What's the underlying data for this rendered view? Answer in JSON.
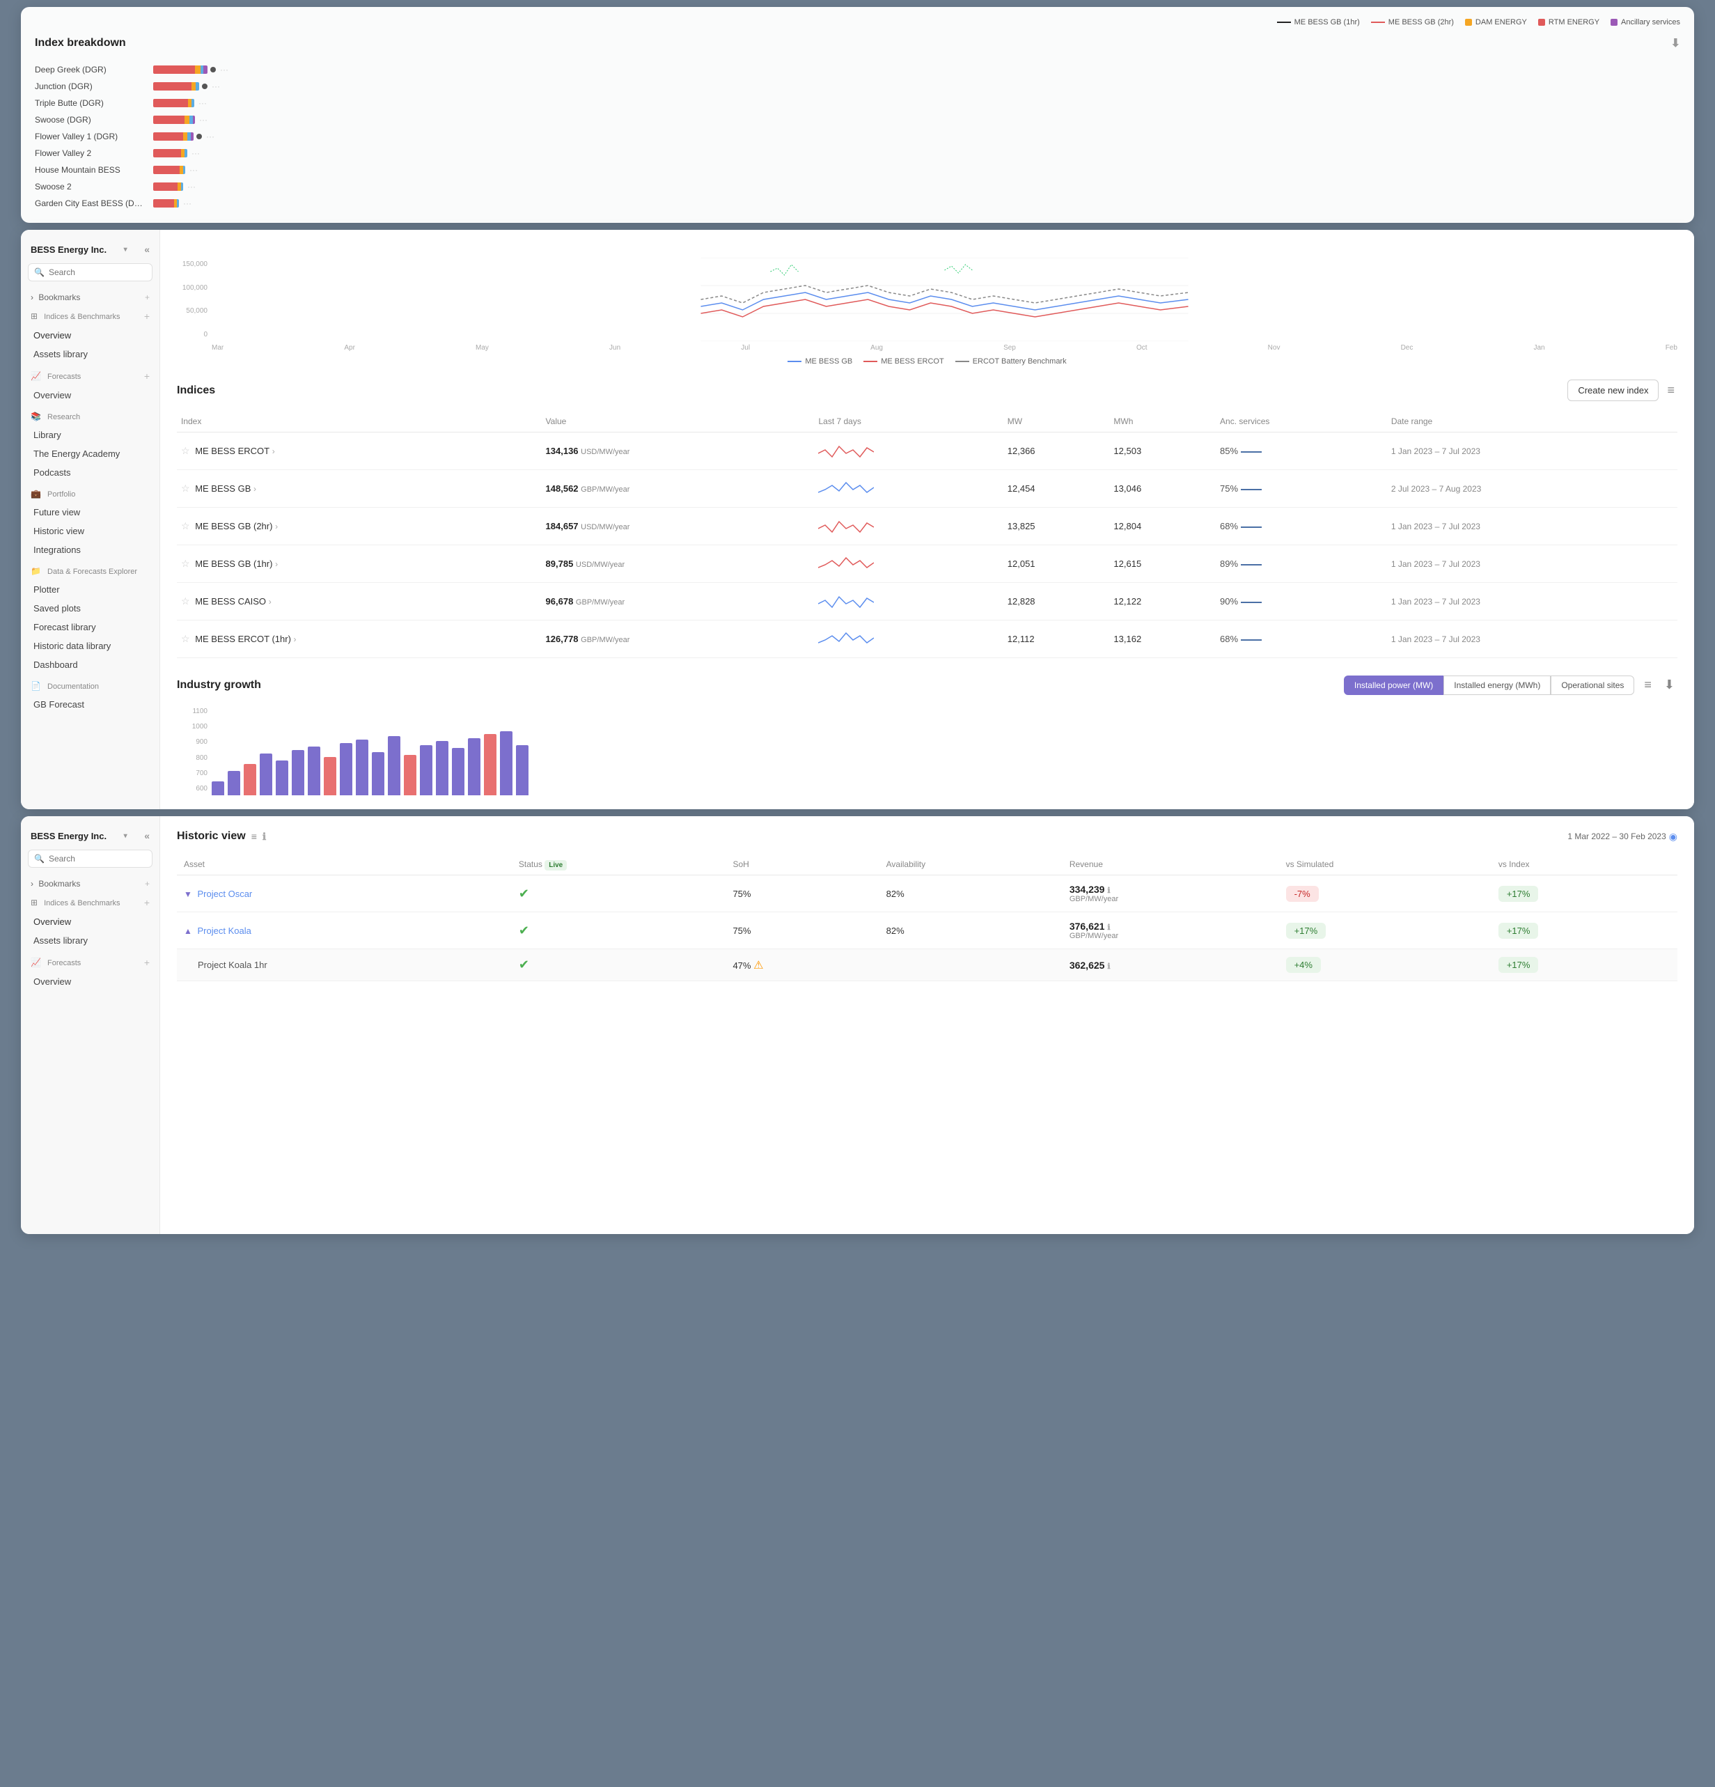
{
  "topPanel": {
    "legend": [
      {
        "label": "ME BESS GB (1hr)",
        "type": "line",
        "color": "#222"
      },
      {
        "label": "ME BESS GB (2hr)",
        "type": "line",
        "color": "#e05a5a"
      },
      {
        "label": "DAM ENERGY",
        "type": "square",
        "color": "#f5a623"
      },
      {
        "label": "RTM ENERGY",
        "type": "square",
        "color": "#e05a5a"
      },
      {
        "label": "Ancillary services",
        "type": "square",
        "color": "#9b59b6"
      }
    ],
    "breakdown": {
      "title": "Index breakdown",
      "rows": [
        {
          "label": "Deep Greek (DGR)",
          "segments": [
            {
              "w": 60,
              "c": "#e05a5a"
            },
            {
              "w": 8,
              "c": "#f5a623"
            },
            {
              "w": 4,
              "c": "#5dade2"
            },
            {
              "w": 6,
              "c": "#9b59b6"
            }
          ],
          "dot": true
        },
        {
          "label": "Junction (DGR)",
          "segments": [
            {
              "w": 55,
              "c": "#e05a5a"
            },
            {
              "w": 6,
              "c": "#f5a623"
            },
            {
              "w": 5,
              "c": "#5dade2"
            }
          ],
          "dot": true
        },
        {
          "label": "Triple Butte (DGR)",
          "segments": [
            {
              "w": 50,
              "c": "#e05a5a"
            },
            {
              "w": 5,
              "c": "#f5a623"
            },
            {
              "w": 4,
              "c": "#5dade2"
            }
          ],
          "dot": false
        },
        {
          "label": "Swoose (DGR)",
          "segments": [
            {
              "w": 45,
              "c": "#e05a5a"
            },
            {
              "w": 7,
              "c": "#f5a623"
            },
            {
              "w": 5,
              "c": "#5dade2"
            },
            {
              "w": 3,
              "c": "#9b59b6"
            }
          ],
          "dot": false
        },
        {
          "label": "Flower Valley 1 (DGR)",
          "segments": [
            {
              "w": 43,
              "c": "#e05a5a"
            },
            {
              "w": 6,
              "c": "#f5a623"
            },
            {
              "w": 5,
              "c": "#5dade2"
            },
            {
              "w": 4,
              "c": "#9b59b6"
            }
          ],
          "dot": true
        },
        {
          "label": "Flower Valley 2",
          "segments": [
            {
              "w": 40,
              "c": "#e05a5a"
            },
            {
              "w": 5,
              "c": "#f5a623"
            },
            {
              "w": 4,
              "c": "#5dade2"
            }
          ],
          "dot": false
        },
        {
          "label": "House Mountain BESS",
          "segments": [
            {
              "w": 38,
              "c": "#e05a5a"
            },
            {
              "w": 5,
              "c": "#f5a623"
            },
            {
              "w": 3,
              "c": "#5dade2"
            }
          ],
          "dot": false
        },
        {
          "label": "Swoose 2",
          "segments": [
            {
              "w": 35,
              "c": "#e05a5a"
            },
            {
              "w": 5,
              "c": "#f5a623"
            },
            {
              "w": 3,
              "c": "#5dade2"
            }
          ],
          "dot": false
        },
        {
          "label": "Garden City East BESS (DGR)",
          "segments": [
            {
              "w": 30,
              "c": "#e05a5a"
            },
            {
              "w": 4,
              "c": "#f5a623"
            },
            {
              "w": 3,
              "c": "#5dade2"
            }
          ],
          "dot": false
        }
      ]
    }
  },
  "window1": {
    "company": "BESS Energy Inc.",
    "search": {
      "placeholder": "Search"
    },
    "bookmarks": "Bookmarks",
    "sidebar": {
      "sections": [
        {
          "name": "Indices & Benchmarks",
          "icon": "chart-icon",
          "addable": true,
          "items": [
            "Overview",
            "Assets library"
          ]
        },
        {
          "name": "Forecasts",
          "icon": "forecast-icon",
          "addable": true,
          "items": [
            "Overview"
          ]
        },
        {
          "name": "Research",
          "icon": "research-icon",
          "addable": false,
          "items": [
            "Library",
            "The Energy Academy",
            "Podcasts"
          ]
        },
        {
          "name": "Portfolio",
          "icon": "portfolio-icon",
          "addable": false,
          "items": [
            "Future view",
            "Historic view",
            "Integrations"
          ]
        },
        {
          "name": "Data & Forecasts Explorer",
          "icon": "explorer-icon",
          "addable": false,
          "items": [
            "Plotter",
            "Saved plots",
            "Forecast library",
            "Historic data library",
            "Dashboard"
          ]
        },
        {
          "name": "Documentation",
          "icon": "doc-icon",
          "addable": false,
          "items": [
            "GB Forecast"
          ]
        }
      ]
    },
    "chart": {
      "yLabels": [
        "150,000",
        "100,000",
        "50,000",
        "0"
      ],
      "xLabels": [
        "Mar",
        "Apr",
        "May",
        "Jun",
        "Jul",
        "Aug",
        "Sep",
        "Oct",
        "Nov",
        "Dec",
        "Jan",
        "Feb"
      ],
      "legend": [
        {
          "label": "ME BESS GB",
          "type": "solid",
          "color": "#5b8dee"
        },
        {
          "label": "ME BESS ERCOT",
          "type": "solid",
          "color": "#e05a5a"
        },
        {
          "label": "ERCOT Battery Benchmark",
          "type": "dashed",
          "color": "#888"
        }
      ]
    },
    "indices": {
      "title": "Indices",
      "createBtn": "Create new index",
      "columns": [
        "Index",
        "Value",
        "Last 7 days",
        "MW",
        "MWh",
        "Anc. services",
        "Date range"
      ],
      "rows": [
        {
          "name": "ME BESS ERCOT",
          "value": "134,136",
          "unit": "USD/MW/year",
          "mw": "12,366",
          "mwh": "12,503",
          "anc": "85%",
          "dateRange": "1 Jan 2023 – 7 Jul 2023",
          "lineColor": "#e05a5a"
        },
        {
          "name": "ME BESS GB",
          "value": "148,562",
          "unit": "GBP/MW/year",
          "mw": "12,454",
          "mwh": "13,046",
          "anc": "75%",
          "dateRange": "2 Jul 2023 – 7 Aug 2023",
          "lineColor": "#5b8dee"
        },
        {
          "name": "ME BESS GB (2hr)",
          "value": "184,657",
          "unit": "USD/MW/year",
          "mw": "13,825",
          "mwh": "12,804",
          "anc": "68%",
          "dateRange": "1 Jan 2023 – 7 Jul 2023",
          "lineColor": "#e05a5a"
        },
        {
          "name": "ME BESS GB (1hr)",
          "value": "89,785",
          "unit": "USD/MW/year",
          "mw": "12,051",
          "mwh": "12,615",
          "anc": "89%",
          "dateRange": "1 Jan 2023 – 7 Jul 2023",
          "lineColor": "#e05a5a"
        },
        {
          "name": "ME BESS CAISO",
          "value": "96,678",
          "unit": "GBP/MW/year",
          "mw": "12,828",
          "mwh": "12,122",
          "anc": "90%",
          "dateRange": "1 Jan 2023 – 7 Jul 2023",
          "lineColor": "#5b8dee"
        },
        {
          "name": "ME BESS ERCOT (1hr)",
          "value": "126,778",
          "unit": "GBP/MW/year",
          "mw": "12,112",
          "mwh": "13,162",
          "anc": "68%",
          "dateRange": "1 Jan 2023 – 7 Jul 2023",
          "lineColor": "#5b8dee"
        }
      ]
    },
    "growth": {
      "title": "Industry growth",
      "tabs": [
        "Installed power (MW)",
        "Installed energy (MWh)",
        "Operational sites"
      ],
      "activeTab": 0,
      "yLabels": [
        "1100",
        "1000",
        "900",
        "800",
        "700",
        "600"
      ],
      "bars": [
        20,
        30,
        40,
        55,
        45,
        60,
        65,
        50,
        70,
        75,
        60,
        80,
        55,
        70,
        75,
        65,
        80,
        85,
        90,
        70
      ]
    }
  },
  "window2": {
    "company": "BESS Energy Inc.",
    "search": {
      "placeholder": "Search"
    },
    "bookmarks": "Bookmarks",
    "sidebar": {
      "sections": [
        {
          "name": "Indices & Benchmarks",
          "icon": "chart-icon",
          "addable": true,
          "items": [
            "Overview",
            "Assets library"
          ]
        },
        {
          "name": "Forecasts",
          "icon": "forecast-icon",
          "addable": true,
          "items": [
            "Overview"
          ]
        }
      ]
    },
    "historicView": {
      "title": "Historic view",
      "dateRange": "1 Mar 2022 – 30 Feb 2023",
      "liveBadge": "Live",
      "columns": [
        "Asset",
        "Status",
        "SoH",
        "Availability",
        "Revenue",
        "vs Simulated",
        "vs Index"
      ],
      "rows": [
        {
          "name": "Project Oscar",
          "expanded": false,
          "expandIcon": "▼",
          "statusOk": true,
          "soh": "75%",
          "availability": "82%",
          "revenue": "334,239",
          "revenueUnit": "GBP/MW/year",
          "vsSimulated": "-7%",
          "vsSimulatedNeg": true,
          "vsIndex": "+17%",
          "vsIndexPos": true
        },
        {
          "name": "Project Koala",
          "expanded": true,
          "expandIcon": "▲",
          "statusOk": true,
          "soh": "75%",
          "availability": "82%",
          "revenue": "376,621",
          "revenueUnit": "GBP/MW/year",
          "vsSimulated": "+17%",
          "vsSimulatedNeg": false,
          "vsIndex": "+17%",
          "vsIndexPos": true
        },
        {
          "name": "Project Koala 1hr",
          "expanded": false,
          "expandIcon": "",
          "statusOk": true,
          "statusWarning": true,
          "soh": "47%",
          "availability": "",
          "revenue": "362,625",
          "revenueUnit": "",
          "vsSimulated": "+4%",
          "vsSimulatedNeg": false,
          "vsIndex": "+17%",
          "vsIndexPos": true
        }
      ]
    }
  },
  "icons": {
    "download": "⬇",
    "filter": "≡",
    "search": "🔍",
    "add": "+",
    "collapse": "«",
    "info": "ℹ",
    "settings": "⚙",
    "eye": "👁"
  }
}
